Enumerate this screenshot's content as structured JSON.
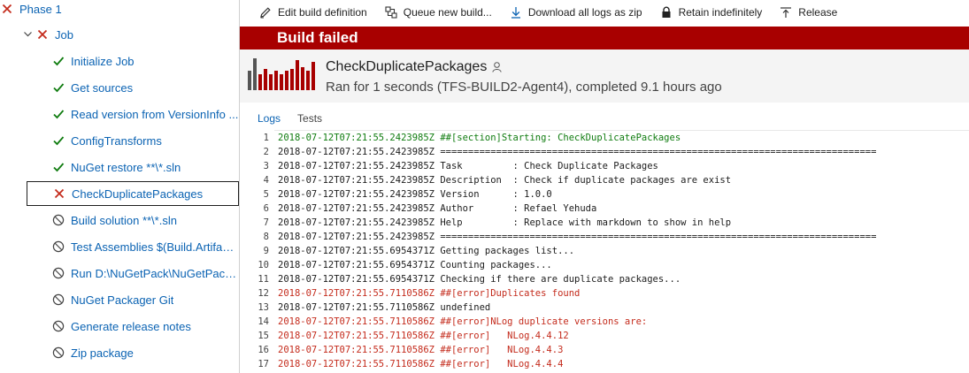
{
  "toolbar": {
    "edit": "Edit build definition",
    "queue": "Queue new build...",
    "download": "Download all logs as zip",
    "retain": "Retain indefinitely",
    "release": "Release"
  },
  "banner": {
    "text": "Build failed"
  },
  "header": {
    "definition_name": "CheckDuplicatePackages",
    "run_info": "Ran for 1 seconds (TFS-BUILD2-Agent4), completed 9.1 hours ago"
  },
  "tabs": {
    "logs": "Logs",
    "tests": "Tests"
  },
  "colors": {
    "failed": "#a80000",
    "success": "#107c10",
    "error": "#c42b1c",
    "link": "#0b63b3"
  },
  "tree": {
    "phase": {
      "label": "Phase 1",
      "status": "failed"
    },
    "job": {
      "label": "Job",
      "status": "failed"
    },
    "steps": [
      {
        "label": "Initialize Job",
        "status": "succeeded"
      },
      {
        "label": "Get sources",
        "status": "succeeded"
      },
      {
        "label": "Read version from VersionInfo ...",
        "status": "succeeded"
      },
      {
        "label": "ConfigTransforms",
        "status": "succeeded"
      },
      {
        "label": "NuGet restore **\\*.sln",
        "status": "succeeded"
      },
      {
        "label": "CheckDuplicatePackages",
        "status": "failed",
        "selected": true
      },
      {
        "label": "Build solution **\\*.sln",
        "status": "skipped"
      },
      {
        "label": "Test Assemblies $(Build.Artifact...",
        "status": "skipped"
      },
      {
        "label": "Run D:\\NuGetPack\\NuGetPack...",
        "status": "skipped"
      },
      {
        "label": "NuGet Packager Git",
        "status": "skipped"
      },
      {
        "label": "Generate release notes",
        "status": "skipped"
      },
      {
        "label": "Zip package",
        "status": "skipped"
      }
    ]
  },
  "log": {
    "lines": [
      {
        "n": "1",
        "text": "2018-07-12T07:21:55.2423985Z ##[section]Starting: CheckDuplicatePackages",
        "kind": "section"
      },
      {
        "n": "2",
        "text": "2018-07-12T07:21:55.2423985Z ==============================================================================",
        "kind": "normal"
      },
      {
        "n": "3",
        "text": "2018-07-12T07:21:55.2423985Z Task         : Check Duplicate Packages",
        "kind": "normal"
      },
      {
        "n": "4",
        "text": "2018-07-12T07:21:55.2423985Z Description  : Check if duplicate packages are exist",
        "kind": "normal"
      },
      {
        "n": "5",
        "text": "2018-07-12T07:21:55.2423985Z Version      : 1.0.0",
        "kind": "normal"
      },
      {
        "n": "6",
        "text": "2018-07-12T07:21:55.2423985Z Author       : Refael Yehuda",
        "kind": "normal"
      },
      {
        "n": "7",
        "text": "2018-07-12T07:21:55.2423985Z Help         : Replace with markdown to show in help",
        "kind": "normal"
      },
      {
        "n": "8",
        "text": "2018-07-12T07:21:55.2423985Z ==============================================================================",
        "kind": "normal"
      },
      {
        "n": "9",
        "text": "2018-07-12T07:21:55.6954371Z Getting packages list...",
        "kind": "normal"
      },
      {
        "n": "10",
        "text": "2018-07-12T07:21:55.6954371Z Counting packages...",
        "kind": "normal"
      },
      {
        "n": "11",
        "text": "2018-07-12T07:21:55.6954371Z Checking if there are duplicate packages...",
        "kind": "normal"
      },
      {
        "n": "12",
        "text": "2018-07-12T07:21:55.7110586Z ##[error]Duplicates found",
        "kind": "error"
      },
      {
        "n": "13",
        "text": "2018-07-12T07:21:55.7110586Z undefined",
        "kind": "normal"
      },
      {
        "n": "14",
        "text": "2018-07-12T07:21:55.7110586Z ##[error]NLog duplicate versions are:",
        "kind": "error"
      },
      {
        "n": "15",
        "text": "2018-07-12T07:21:55.7110586Z ##[error]   NLog.4.4.12",
        "kind": "error"
      },
      {
        "n": "16",
        "text": "2018-07-12T07:21:55.7110586Z ##[error]   NLog.4.4.3",
        "kind": "error"
      },
      {
        "n": "17",
        "text": "2018-07-12T07:21:55.7110586Z ##[error]   NLog.4.4.4",
        "kind": "error"
      }
    ]
  }
}
